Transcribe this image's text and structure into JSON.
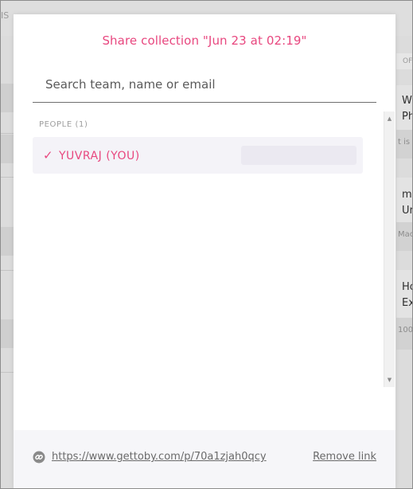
{
  "background": {
    "top_fragment": "IS",
    "tag": "OF",
    "cards": [
      {
        "line1": "W",
        "line2": "Ph",
        "sub": "t is a"
      },
      {
        "line1": "m",
        "line2": "Ur",
        "sub": "Mac"
      },
      {
        "line1": "Ho",
        "line2": "Ex",
        "sub": "100_"
      }
    ]
  },
  "modal": {
    "title": "Share collection \"Jun 23 at 02:19\"",
    "search": {
      "placeholder": "Search team, name or email",
      "value": ""
    },
    "people_section": {
      "label": "PEOPLE (1)",
      "items": [
        {
          "check": "✓",
          "name": "YUVRAJ (YOU)",
          "selected": true
        }
      ]
    },
    "footer": {
      "link_icon": "link-icon",
      "url": "https://www.gettoby.com/p/70a1zjah0qcy",
      "remove_label": "Remove link"
    }
  },
  "colors": {
    "accent": "#e8477f",
    "muted_text": "#6a6a6a",
    "row_bg": "#f4f3f8",
    "footer_bg": "#f6f6f9"
  }
}
